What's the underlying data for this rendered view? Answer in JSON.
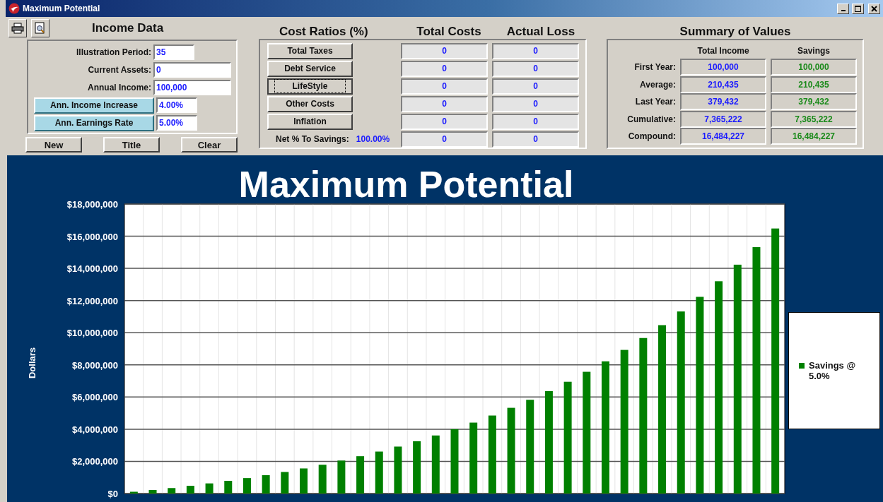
{
  "window": {
    "title": "Maximum Potential"
  },
  "income_data": {
    "title": "Income Data",
    "fields": [
      {
        "label": "Illustration Period:",
        "kind": "label",
        "value": "35"
      },
      {
        "label": "Current Assets:",
        "kind": "label",
        "value": "0"
      },
      {
        "label": "Annual Income:",
        "kind": "label",
        "value": "100,000"
      },
      {
        "label": "Ann. Income Increase",
        "kind": "button",
        "value": "4.00%"
      },
      {
        "label": "Ann. Earnings Rate",
        "kind": "button",
        "value": "5.00%"
      }
    ],
    "buttons": [
      "New",
      "Title",
      "Clear"
    ]
  },
  "cost_ratios": {
    "title": "Cost Ratios (%)",
    "total_costs_title": "Total Costs",
    "actual_loss_title": "Actual Loss",
    "rows": [
      {
        "label": "Total Taxes",
        "focused": false,
        "total_cost": "0",
        "actual_loss": "0"
      },
      {
        "label": "Debt Service",
        "focused": false,
        "total_cost": "0",
        "actual_loss": "0"
      },
      {
        "label": "LifeStyle",
        "focused": true,
        "total_cost": "0",
        "actual_loss": "0"
      },
      {
        "label": "Other Costs",
        "focused": false,
        "total_cost": "0",
        "actual_loss": "0"
      },
      {
        "label": "Inflation",
        "focused": false,
        "total_cost": "0",
        "actual_loss": "0"
      }
    ],
    "net": {
      "label": "Net % To Savings:",
      "value": "100.00%",
      "total_cost": "0",
      "actual_loss": "0"
    }
  },
  "summary": {
    "title": "Summary of Values",
    "columns": [
      "Total Income",
      "Savings"
    ],
    "rows": [
      {
        "label": "First Year:",
        "total_income": "100,000",
        "savings": "100,000"
      },
      {
        "label": "Average:",
        "total_income": "210,435",
        "savings": "210,435"
      },
      {
        "label": "Last Year:",
        "total_income": "379,432",
        "savings": "379,432"
      },
      {
        "label": "Cumulative:",
        "total_income": "7,365,222",
        "savings": "7,365,222"
      },
      {
        "label": "Compound:",
        "total_income": "16,484,227",
        "savings": "16,484,227"
      }
    ]
  },
  "chart": {
    "chart_data": {
      "type": "bar",
      "title": "Maximum Potential",
      "ylabel": "Dollars",
      "ylim": [
        0,
        18000000
      ],
      "grid": true,
      "yticks": [
        {
          "value": 0,
          "label": "$0"
        },
        {
          "value": 2000000,
          "label": "$2,000,000"
        },
        {
          "value": 4000000,
          "label": "$4,000,000"
        },
        {
          "value": 6000000,
          "label": "$6,000,000"
        },
        {
          "value": 8000000,
          "label": "$8,000,000"
        },
        {
          "value": 10000000,
          "label": "$10,000,000"
        },
        {
          "value": 12000000,
          "label": "$12,000,000"
        },
        {
          "value": 14000000,
          "label": "$14,000,000"
        },
        {
          "value": 16000000,
          "label": "$16,000,000"
        },
        {
          "value": 18000000,
          "label": "$18,000,000"
        }
      ],
      "series": [
        {
          "name": "Savings @ 5.0%",
          "color": "#008000",
          "values": [
            110000,
            220000,
            340000,
            480000,
            630000,
            790000,
            960000,
            1140000,
            1340000,
            1560000,
            1790000,
            2050000,
            2320000,
            2610000,
            2920000,
            3250000,
            3610000,
            4000000,
            4410000,
            4850000,
            5330000,
            5830000,
            6370000,
            6950000,
            7570000,
            8220000,
            8930000,
            9670000,
            10470000,
            11320000,
            12230000,
            13200000,
            14230000,
            15320000,
            16480000
          ]
        }
      ]
    }
  }
}
